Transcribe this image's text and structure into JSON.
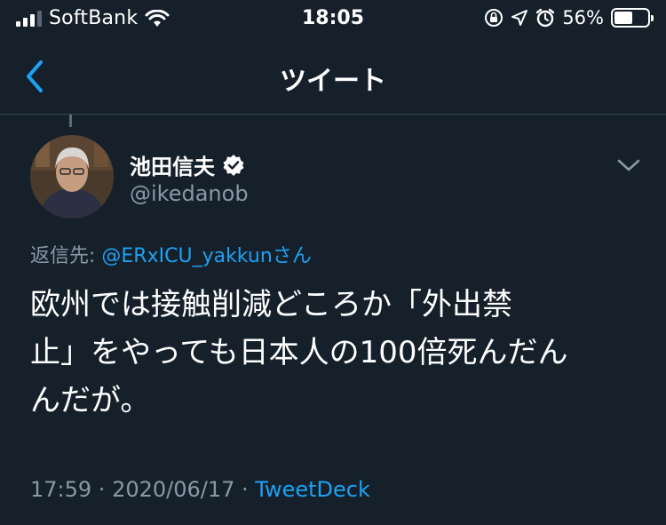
{
  "status_bar": {
    "carrier": "SoftBank",
    "time": "18:05",
    "battery_percent": "56%",
    "battery_level": 0.56,
    "icons": [
      "signal-icon",
      "wifi-icon",
      "rotation-lock-icon",
      "location-icon",
      "alarm-icon",
      "battery-icon"
    ]
  },
  "nav": {
    "title": "ツイート",
    "back_icon": "chevron-left-icon"
  },
  "tweet": {
    "author_name": "池田信夫",
    "handle": "@ikedanob",
    "verified": true,
    "reply_prefix": "返信先: ",
    "reply_mention": "@ERxICU_yakkun",
    "reply_suffix": "さん",
    "text_lines": [
      "欧州では接触削減どころか「外出禁",
      "止」をやっても日本人の100倍死んだん",
      "んだが。"
    ],
    "time": "17:59",
    "separator": " · ",
    "date": "2020/06/17",
    "source": "TweetDeck"
  },
  "colors": {
    "background": "#15202b",
    "accent": "#1da1f2",
    "muted": "#8899a6",
    "border": "#38444d"
  }
}
